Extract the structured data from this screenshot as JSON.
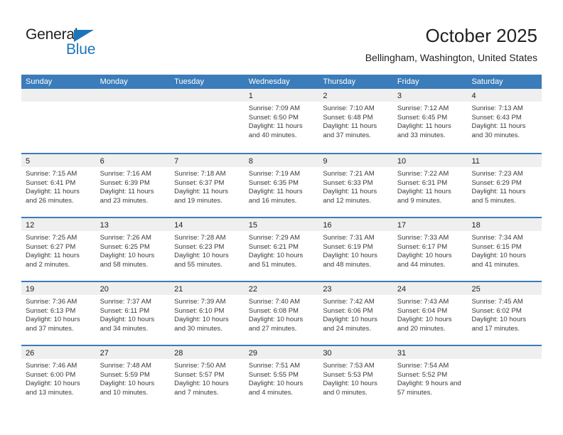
{
  "brand": {
    "name_part1": "General",
    "name_part2": "Blue",
    "triangle_icon": "triangle-icon",
    "accent_color": "#1b75bb"
  },
  "header": {
    "title": "October 2025",
    "subtitle": "Bellingham, Washington, United States"
  },
  "theme": {
    "header_blue": "#3b7cba",
    "date_band_gray": "#efefef",
    "text_color": "#231f20"
  },
  "calendar": {
    "weekdays": [
      "Sunday",
      "Monday",
      "Tuesday",
      "Wednesday",
      "Thursday",
      "Friday",
      "Saturday"
    ],
    "weeks": [
      [
        {
          "day": "",
          "lines": []
        },
        {
          "day": "",
          "lines": []
        },
        {
          "day": "",
          "lines": []
        },
        {
          "day": "1",
          "lines": [
            "Sunrise: 7:09 AM",
            "Sunset: 6:50 PM",
            "Daylight: 11 hours and 40 minutes."
          ]
        },
        {
          "day": "2",
          "lines": [
            "Sunrise: 7:10 AM",
            "Sunset: 6:48 PM",
            "Daylight: 11 hours and 37 minutes."
          ]
        },
        {
          "day": "3",
          "lines": [
            "Sunrise: 7:12 AM",
            "Sunset: 6:45 PM",
            "Daylight: 11 hours and 33 minutes."
          ]
        },
        {
          "day": "4",
          "lines": [
            "Sunrise: 7:13 AM",
            "Sunset: 6:43 PM",
            "Daylight: 11 hours and 30 minutes."
          ]
        }
      ],
      [
        {
          "day": "5",
          "lines": [
            "Sunrise: 7:15 AM",
            "Sunset: 6:41 PM",
            "Daylight: 11 hours and 26 minutes."
          ]
        },
        {
          "day": "6",
          "lines": [
            "Sunrise: 7:16 AM",
            "Sunset: 6:39 PM",
            "Daylight: 11 hours and 23 minutes."
          ]
        },
        {
          "day": "7",
          "lines": [
            "Sunrise: 7:18 AM",
            "Sunset: 6:37 PM",
            "Daylight: 11 hours and 19 minutes."
          ]
        },
        {
          "day": "8",
          "lines": [
            "Sunrise: 7:19 AM",
            "Sunset: 6:35 PM",
            "Daylight: 11 hours and 16 minutes."
          ]
        },
        {
          "day": "9",
          "lines": [
            "Sunrise: 7:21 AM",
            "Sunset: 6:33 PM",
            "Daylight: 11 hours and 12 minutes."
          ]
        },
        {
          "day": "10",
          "lines": [
            "Sunrise: 7:22 AM",
            "Sunset: 6:31 PM",
            "Daylight: 11 hours and 9 minutes."
          ]
        },
        {
          "day": "11",
          "lines": [
            "Sunrise: 7:23 AM",
            "Sunset: 6:29 PM",
            "Daylight: 11 hours and 5 minutes."
          ]
        }
      ],
      [
        {
          "day": "12",
          "lines": [
            "Sunrise: 7:25 AM",
            "Sunset: 6:27 PM",
            "Daylight: 11 hours and 2 minutes."
          ]
        },
        {
          "day": "13",
          "lines": [
            "Sunrise: 7:26 AM",
            "Sunset: 6:25 PM",
            "Daylight: 10 hours and 58 minutes."
          ]
        },
        {
          "day": "14",
          "lines": [
            "Sunrise: 7:28 AM",
            "Sunset: 6:23 PM",
            "Daylight: 10 hours and 55 minutes."
          ]
        },
        {
          "day": "15",
          "lines": [
            "Sunrise: 7:29 AM",
            "Sunset: 6:21 PM",
            "Daylight: 10 hours and 51 minutes."
          ]
        },
        {
          "day": "16",
          "lines": [
            "Sunrise: 7:31 AM",
            "Sunset: 6:19 PM",
            "Daylight: 10 hours and 48 minutes."
          ]
        },
        {
          "day": "17",
          "lines": [
            "Sunrise: 7:33 AM",
            "Sunset: 6:17 PM",
            "Daylight: 10 hours and 44 minutes."
          ]
        },
        {
          "day": "18",
          "lines": [
            "Sunrise: 7:34 AM",
            "Sunset: 6:15 PM",
            "Daylight: 10 hours and 41 minutes."
          ]
        }
      ],
      [
        {
          "day": "19",
          "lines": [
            "Sunrise: 7:36 AM",
            "Sunset: 6:13 PM",
            "Daylight: 10 hours and 37 minutes."
          ]
        },
        {
          "day": "20",
          "lines": [
            "Sunrise: 7:37 AM",
            "Sunset: 6:11 PM",
            "Daylight: 10 hours and 34 minutes."
          ]
        },
        {
          "day": "21",
          "lines": [
            "Sunrise: 7:39 AM",
            "Sunset: 6:10 PM",
            "Daylight: 10 hours and 30 minutes."
          ]
        },
        {
          "day": "22",
          "lines": [
            "Sunrise: 7:40 AM",
            "Sunset: 6:08 PM",
            "Daylight: 10 hours and 27 minutes."
          ]
        },
        {
          "day": "23",
          "lines": [
            "Sunrise: 7:42 AM",
            "Sunset: 6:06 PM",
            "Daylight: 10 hours and 24 minutes."
          ]
        },
        {
          "day": "24",
          "lines": [
            "Sunrise: 7:43 AM",
            "Sunset: 6:04 PM",
            "Daylight: 10 hours and 20 minutes."
          ]
        },
        {
          "day": "25",
          "lines": [
            "Sunrise: 7:45 AM",
            "Sunset: 6:02 PM",
            "Daylight: 10 hours and 17 minutes."
          ]
        }
      ],
      [
        {
          "day": "26",
          "lines": [
            "Sunrise: 7:46 AM",
            "Sunset: 6:00 PM",
            "Daylight: 10 hours and 13 minutes."
          ]
        },
        {
          "day": "27",
          "lines": [
            "Sunrise: 7:48 AM",
            "Sunset: 5:59 PM",
            "Daylight: 10 hours and 10 minutes."
          ]
        },
        {
          "day": "28",
          "lines": [
            "Sunrise: 7:50 AM",
            "Sunset: 5:57 PM",
            "Daylight: 10 hours and 7 minutes."
          ]
        },
        {
          "day": "29",
          "lines": [
            "Sunrise: 7:51 AM",
            "Sunset: 5:55 PM",
            "Daylight: 10 hours and 4 minutes."
          ]
        },
        {
          "day": "30",
          "lines": [
            "Sunrise: 7:53 AM",
            "Sunset: 5:53 PM",
            "Daylight: 10 hours and 0 minutes."
          ]
        },
        {
          "day": "31",
          "lines": [
            "Sunrise: 7:54 AM",
            "Sunset: 5:52 PM",
            "Daylight: 9 hours and 57 minutes."
          ]
        },
        {
          "day": "",
          "lines": []
        }
      ]
    ]
  }
}
